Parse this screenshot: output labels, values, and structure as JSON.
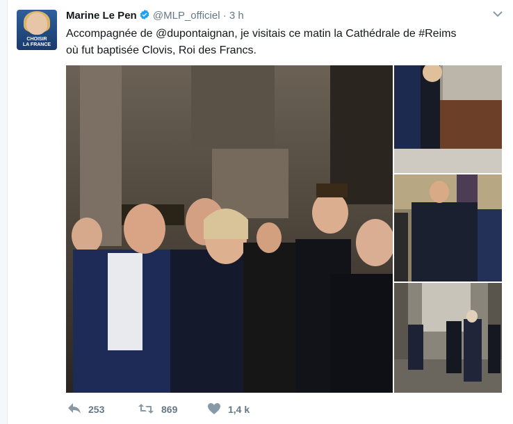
{
  "tweet": {
    "author_name": "Marine Le Pen",
    "handle": "@MLP_officiel",
    "separator": "·",
    "time": "3 h",
    "text_line1": "Accompagnée de @dupontaignan, je visitais ce matin la Cathédrale de #Reims",
    "text_line2": "où fut baptisée Clovis, Roi des Francs.",
    "avatar_text_line1": "CHOISIR",
    "avatar_text_line2": "LA FRANCE"
  },
  "actions": {
    "reply_count": "253",
    "retweet_count": "869",
    "like_count": "1,4 k"
  },
  "colors": {
    "verified": "#1da1f2",
    "muted": "#657786",
    "text": "#14171a"
  },
  "icons": [
    "verified-badge-icon",
    "chevron-down-icon",
    "reply-icon",
    "retweet-icon",
    "like-icon"
  ]
}
